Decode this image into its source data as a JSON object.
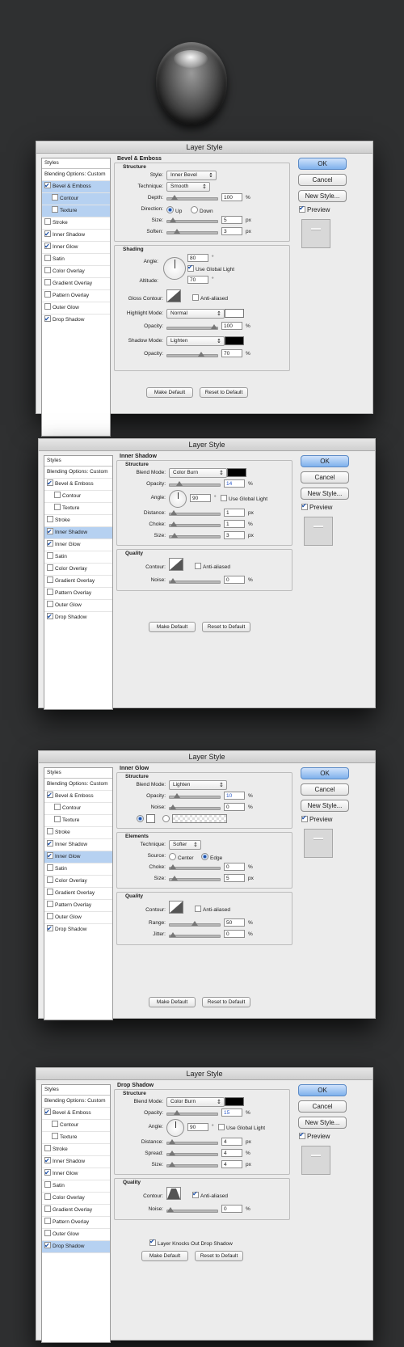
{
  "title": "Layer Style",
  "side": {
    "ok": "OK",
    "cancel": "Cancel",
    "new_style": "New Style...",
    "preview": "Preview"
  },
  "list": {
    "header": "Styles",
    "items": [
      "Blending Options: Custom",
      "Bevel & Emboss",
      "Contour",
      "Texture",
      "Stroke",
      "Inner Shadow",
      "Inner Glow",
      "Satin",
      "Color Overlay",
      "Gradient Overlay",
      "Pattern Overlay",
      "Outer Glow",
      "Drop Shadow"
    ]
  },
  "bottom_buttons": {
    "make_default": "Make Default",
    "reset_default": "Reset to Default"
  },
  "bevel": {
    "section": "Bevel & Emboss",
    "structure": "Structure",
    "style_label": "Style:",
    "style_value": "Inner Bevel",
    "technique_label": "Technique:",
    "technique_value": "Smooth",
    "depth_label": "Depth:",
    "depth_value": "100",
    "depth_unit": "%",
    "direction_label": "Direction:",
    "up": "Up",
    "down": "Down",
    "size_label": "Size:",
    "size_value": "5",
    "size_unit": "px",
    "soften_label": "Soften:",
    "soften_value": "3",
    "soften_unit": "px",
    "shading": "Shading",
    "angle_label": "Angle:",
    "angle_value": "80",
    "angle_unit": "°",
    "global_light": "Use Global Light",
    "altitude_label": "Altitude:",
    "altitude_value": "70",
    "altitude_unit": "°",
    "gloss_label": "Gloss Contour:",
    "anti_aliased": "Anti-aliased",
    "highlight_label": "Highlight Mode:",
    "highlight_value": "Normal",
    "opacity_label": "Opacity:",
    "highlight_opacity": "100",
    "pct": "%",
    "shadow_label": "Shadow Mode:",
    "shadow_value": "Lighten",
    "shadow_opacity": "70",
    "highlight_color": "#ffffff",
    "shadow_color": "#000000"
  },
  "inner_shadow": {
    "section": "Inner Shadow",
    "structure": "Structure",
    "blend_label": "Blend Mode:",
    "blend_value": "Color Burn",
    "opacity_label": "Opacity:",
    "opacity_value": "14",
    "pct": "%",
    "angle_label": "Angle:",
    "angle_value": "90",
    "deg": "°",
    "global_light": "Use Global Light",
    "distance_label": "Distance:",
    "distance_value": "1",
    "px": "px",
    "choke_label": "Choke:",
    "choke_value": "1",
    "size_label": "Size:",
    "size_value": "3",
    "quality": "Quality",
    "contour_label": "Contour:",
    "anti_aliased": "Anti-aliased",
    "noise_label": "Noise:",
    "noise_value": "0",
    "color": "#000000"
  },
  "inner_glow": {
    "section": "Inner Glow",
    "structure": "Structure",
    "blend_label": "Blend Mode:",
    "blend_value": "Lighten",
    "opacity_label": "Opacity:",
    "opacity_value": "10",
    "pct": "%",
    "noise_label": "Noise:",
    "noise_value": "0",
    "elements": "Elements",
    "technique_label": "Technique:",
    "technique_value": "Softer",
    "source_label": "Source:",
    "center": "Center",
    "edge": "Edge",
    "choke_label": "Choke:",
    "choke_value": "0",
    "size_label": "Size:",
    "size_value": "5",
    "px": "px",
    "quality": "Quality",
    "contour_label": "Contour:",
    "anti_aliased": "Anti-aliased",
    "range_label": "Range:",
    "range_value": "50",
    "jitter_label": "Jitter:",
    "jitter_value": "0"
  },
  "drop_shadow": {
    "section": "Drop Shadow",
    "structure": "Structure",
    "blend_label": "Blend Mode:",
    "blend_value": "Color Burn",
    "opacity_label": "Opacity:",
    "opacity_value": "15",
    "pct": "%",
    "angle_label": "Angle:",
    "angle_value": "90",
    "deg": "°",
    "global_light": "Use Global Light",
    "distance_label": "Distance:",
    "distance_value": "4",
    "px": "px",
    "spread_label": "Spread:",
    "spread_value": "4",
    "size_label": "Size:",
    "size_value": "4",
    "quality": "Quality",
    "contour_label": "Contour:",
    "anti_aliased": "Anti-aliased",
    "noise_label": "Noise:",
    "noise_value": "0",
    "knockout": "Layer Knocks Out Drop Shadow",
    "color": "#000000"
  },
  "slider_levels": {
    "depth": 0.1,
    "size": 0.05,
    "soften": 0.15,
    "highlight_opacity": 1.0,
    "shadow_opacity": 0.7,
    "is_opacity": 0.14,
    "is_distance": 0.02,
    "is_choke": 0.01,
    "is_size": 0.03,
    "is_noise": 0.0,
    "ig_opacity": 0.1,
    "ig_noise": 0.0,
    "ig_choke": 0.0,
    "ig_size": 0.03,
    "ig_range": 0.5,
    "ig_jitter": 0.0,
    "ds_opacity": 0.15,
    "ds_distance": 0.04,
    "ds_spread": 0.04,
    "ds_size": 0.04,
    "ds_noise": 0.0
  }
}
